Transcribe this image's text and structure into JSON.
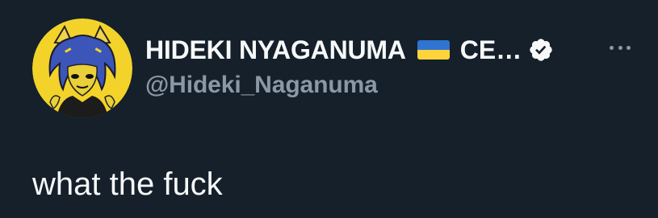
{
  "author": {
    "display_name": "HIDEKI NYAGANUMA",
    "name_suffix": "CE…",
    "handle": "@Hideki_Naganuma",
    "verified": true,
    "flag": "Ukraine",
    "avatar_icon": "avatar-illustration"
  },
  "tweet": {
    "text": "what the fuck"
  },
  "icons": {
    "more": "more-options-icon",
    "verified": "verified-badge-icon"
  },
  "colors": {
    "background": "#15202b",
    "text_primary": "#f7f9f9",
    "text_secondary": "#8b98a5",
    "avatar_bg": "#f3d32a",
    "flag_blue": "#2f74d0",
    "flag_yellow": "#ffd43a"
  }
}
